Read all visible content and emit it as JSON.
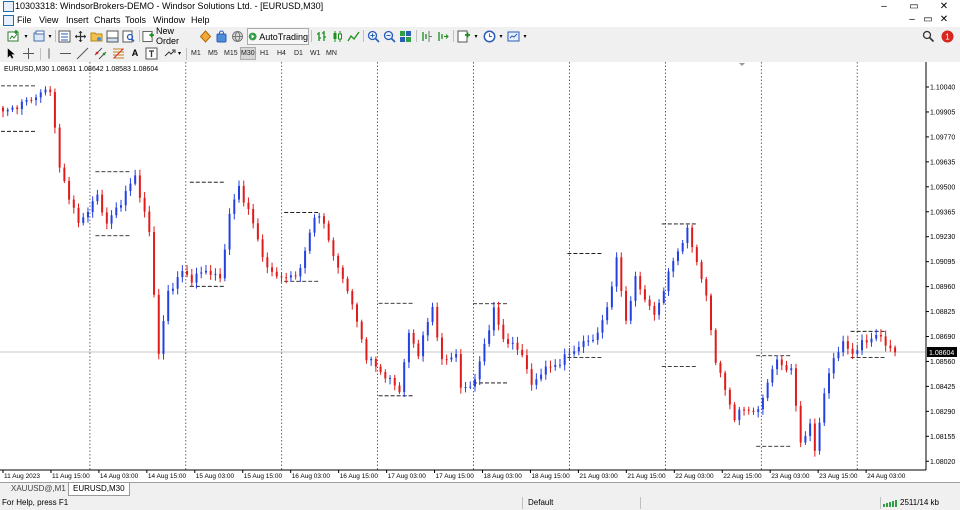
{
  "window": {
    "title": "10303318: WindsorBrokers-DEMO - Windsor Solutions Ltd. - [EURUSD,M30]"
  },
  "menu": [
    "File",
    "View",
    "Insert",
    "Charts",
    "Tools",
    "Window",
    "Help"
  ],
  "toolbar": {
    "new_order": "New Order",
    "auto_trading": "AutoTrading"
  },
  "notifications": {
    "count": "1"
  },
  "timeframes": [
    "M1",
    "M5",
    "M15",
    "M30",
    "H1",
    "H4",
    "D1",
    "W1",
    "MN"
  ],
  "active_timeframe": "M30",
  "chart": {
    "header": "EURUSD,M30  1.08631 1.08642 1.08583 1.08604",
    "current_price": "1.08604",
    "colors": {
      "bull": "#2340e0",
      "bear": "#e01b1b",
      "grid": "#000000",
      "price_line": "#c0c0c0"
    }
  },
  "tabs": [
    "XAUUSD@,M1",
    "EURUSD,M30"
  ],
  "active_tab": 1,
  "status": {
    "help": "For Help, press F1",
    "profile": "Default",
    "traffic": "2511/14 kb"
  },
  "chart_data": {
    "type": "candlestick",
    "symbol": "EURUSD",
    "timeframe": "M30",
    "ohlc_last": {
      "open": 1.08631,
      "high": 1.08642,
      "low": 1.08583,
      "close": 1.08604
    },
    "ylim": [
      1.08,
      1.101
    ],
    "y_ticks": [
      "1.10040",
      "1.09905",
      "1.09770",
      "1.09635",
      "1.09500",
      "1.09365",
      "1.09230",
      "1.09095",
      "1.08960",
      "1.08825",
      "1.08690",
      "1.08560",
      "1.08425",
      "1.08290",
      "1.08155",
      "1.08020"
    ],
    "x_ticks": [
      "11 Aug 2023",
      "11 Aug 15:00",
      "14 Aug 03:00",
      "14 Aug 15:00",
      "15 Aug 03:00",
      "15 Aug 15:00",
      "16 Aug 03:00",
      "16 Aug 15:00",
      "17 Aug 03:00",
      "17 Aug 15:00",
      "18 Aug 03:00",
      "18 Aug 15:00",
      "21 Aug 03:00",
      "21 Aug 15:00",
      "22 Aug 03:00",
      "22 Aug 15:00",
      "23 Aug 03:00",
      "23 Aug 15:00",
      "24 Aug 03:00"
    ],
    "price_path": [
      [
        0,
        1.099
      ],
      [
        4,
        1.0995
      ],
      [
        10,
        1.1003
      ],
      [
        12,
        1.096
      ],
      [
        16,
        1.093
      ],
      [
        20,
        1.0945
      ],
      [
        22,
        1.093
      ],
      [
        25,
        1.0942
      ],
      [
        28,
        1.0956
      ],
      [
        31,
        1.0925
      ],
      [
        33,
        1.086
      ],
      [
        35,
        1.0893
      ],
      [
        38,
        1.0904
      ],
      [
        40,
        1.09
      ],
      [
        43,
        1.0905
      ],
      [
        46,
        1.09
      ],
      [
        48,
        1.0935
      ],
      [
        50,
        1.095
      ],
      [
        53,
        1.093
      ],
      [
        56,
        1.0905
      ],
      [
        60,
        1.09
      ],
      [
        63,
        1.0905
      ],
      [
        66,
        1.0935
      ],
      [
        68,
        1.093
      ],
      [
        71,
        1.0905
      ],
      [
        73,
        1.0895
      ],
      [
        77,
        1.0858
      ],
      [
        80,
        1.085
      ],
      [
        84,
        1.084
      ],
      [
        86,
        1.087
      ],
      [
        88,
        1.086
      ],
      [
        91,
        1.0885
      ],
      [
        93,
        1.0855
      ],
      [
        96,
        1.086
      ],
      [
        97,
        1.084
      ],
      [
        100,
        1.0845
      ],
      [
        102,
        1.0865
      ],
      [
        104,
        1.0883
      ],
      [
        106,
        1.0868
      ],
      [
        110,
        1.086
      ],
      [
        112,
        1.0842
      ],
      [
        114,
        1.085
      ],
      [
        118,
        1.0855
      ],
      [
        120,
        1.086
      ],
      [
        124,
        1.0867
      ],
      [
        126,
        1.087
      ],
      [
        128,
        1.0885
      ],
      [
        130,
        1.091
      ],
      [
        132,
        1.0878
      ],
      [
        134,
        1.09
      ],
      [
        136,
        1.089
      ],
      [
        138,
        1.088
      ],
      [
        140,
        1.0895
      ],
      [
        142,
        1.091
      ],
      [
        145,
        1.0926
      ],
      [
        147,
        1.091
      ],
      [
        149,
        1.089
      ],
      [
        151,
        1.0856
      ],
      [
        153,
        1.084
      ],
      [
        155,
        1.0825
      ],
      [
        157,
        1.083
      ],
      [
        160,
        1.0828
      ],
      [
        162,
        1.0845
      ],
      [
        164,
        1.0856
      ],
      [
        167,
        1.085
      ],
      [
        168,
        1.0832
      ],
      [
        169,
        1.0812
      ],
      [
        171,
        1.082
      ],
      [
        172,
        1.0808
      ],
      [
        174,
        1.0838
      ],
      [
        176,
        1.0858
      ],
      [
        178,
        1.0865
      ],
      [
        180,
        1.086
      ],
      [
        182,
        1.0865
      ],
      [
        185,
        1.087
      ],
      [
        187,
        1.0865
      ],
      [
        189,
        1.0862
      ]
    ]
  }
}
